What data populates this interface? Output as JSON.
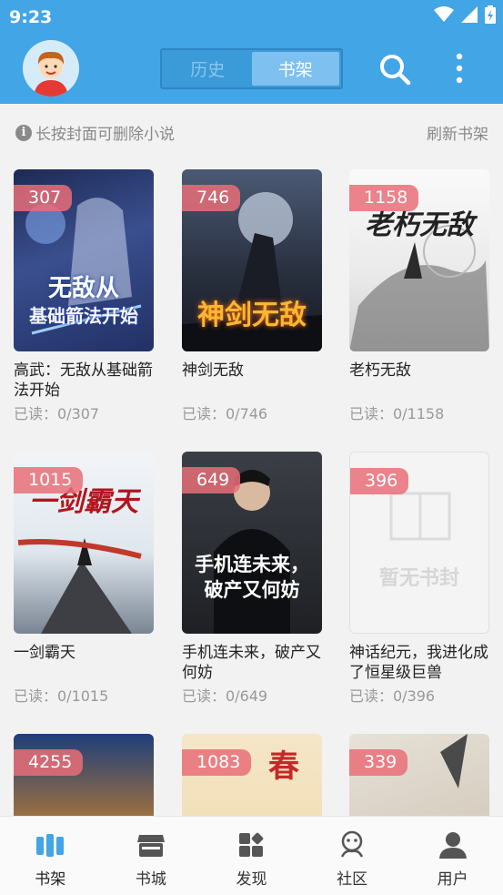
{
  "status_bar": {
    "time": "9:23"
  },
  "header": {
    "tabs": [
      {
        "label": "历史",
        "active": false
      },
      {
        "label": "书架",
        "active": true
      }
    ]
  },
  "tip": {
    "text": "长按封面可删除小说",
    "icon": "info-icon"
  },
  "refresh_label": "刷新书架",
  "books": [
    {
      "count": "307",
      "title": "高武：无敌从基础箭法开始",
      "progress": "已读：0/307",
      "cover_text": "无敌从基础箭法开始"
    },
    {
      "count": "746",
      "title": "神剑无敌",
      "progress": "已读：0/746",
      "cover_text": "神剑无敌"
    },
    {
      "count": "1158",
      "title": "老朽无敌",
      "progress": "已读：0/1158",
      "cover_text": "老朽无敌"
    },
    {
      "count": "1015",
      "title": "一剑霸天",
      "progress": "已读：0/1015",
      "cover_text": "一剑霸天"
    },
    {
      "count": "649",
      "title": "手机连未来，破产又何妨",
      "progress": "已读：0/649",
      "cover_text": "手机连未来，破产又何妨"
    },
    {
      "count": "396",
      "title": "神话纪元，我进化成了恒星级巨兽",
      "progress": "已读：0/396",
      "cover_text": "暂无书封"
    },
    {
      "count": "4255",
      "title": "",
      "progress": "",
      "cover_text": ""
    },
    {
      "count": "1083",
      "title": "",
      "progress": "",
      "cover_text": "春"
    },
    {
      "count": "339",
      "title": "",
      "progress": "",
      "cover_text": ""
    }
  ],
  "bottom_nav": [
    {
      "label": "书架",
      "icon": "bookshelf-icon",
      "active": true
    },
    {
      "label": "书城",
      "icon": "store-icon",
      "active": false
    },
    {
      "label": "发现",
      "icon": "discover-icon",
      "active": false
    },
    {
      "label": "社区",
      "icon": "community-icon",
      "active": false
    },
    {
      "label": "用户",
      "icon": "user-icon",
      "active": false
    }
  ],
  "colors": {
    "primary": "#42a5e6",
    "badge": "#e86e78",
    "nav_active": "#42a5e6"
  }
}
